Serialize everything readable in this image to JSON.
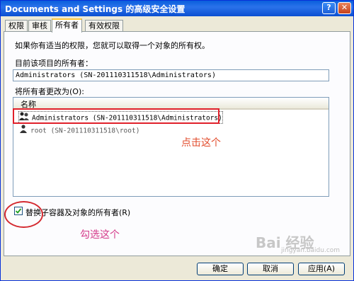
{
  "window": {
    "title": "Documents and Settings 的高级安全设置"
  },
  "tabs": [
    {
      "label": "权限"
    },
    {
      "label": "审核"
    },
    {
      "label": "所有者"
    },
    {
      "label": "有效权限"
    }
  ],
  "active_tab": "所有者",
  "panel": {
    "intro": "如果你有适当的权限，您就可以取得一个对象的所有权。",
    "current_owner_label": "目前该项目的所有者：",
    "current_owner_value": "Administrators (SN-201110311518\\Administrators)",
    "change_owner_label": "将所有者更改为(O):",
    "list_header": "名称",
    "list_items": [
      {
        "name": "Administrators (SN-201110311518\\Administrators)",
        "selected": true
      },
      {
        "name": "root (SN-201110311518\\root)",
        "selected": false
      }
    ],
    "replace_checkbox_label": "替换子容器及对象的所有者(R)",
    "replace_checked": true
  },
  "annotations": {
    "click_this": "点击这个",
    "check_this": "勾选这个"
  },
  "buttons": {
    "ok": "确定",
    "cancel": "取消",
    "apply": "应用(A)"
  },
  "watermark": {
    "logo": "Bai 经验",
    "url": "jingyan.baidu.com"
  },
  "colors": {
    "annotation_red": "#e0202a",
    "titlebar": "#0a5fdc",
    "tab_highlight": "#ffc73c"
  }
}
